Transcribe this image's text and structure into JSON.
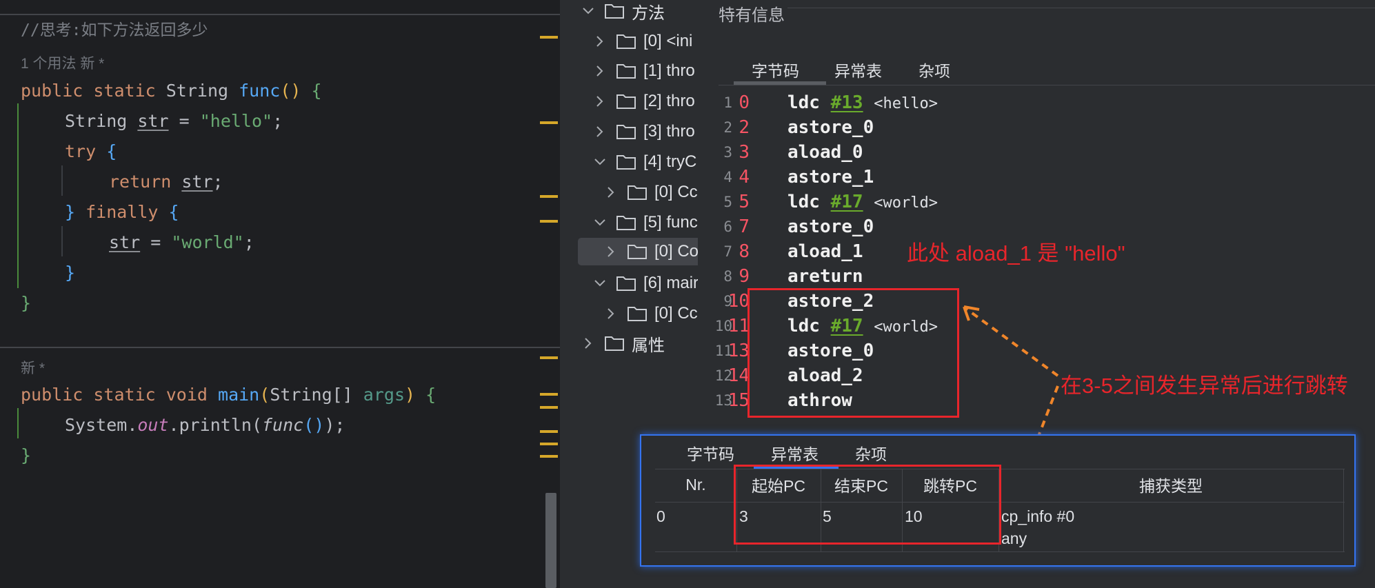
{
  "editor": {
    "comment": "//思考:如下方法返回多少",
    "usage_hint": "1 个用法   新 *",
    "new_hint": "新 *",
    "func": {
      "line1": [
        "public",
        "static",
        "String",
        "func",
        "()",
        "{"
      ],
      "line2": [
        "String",
        "str",
        "=",
        "\"hello\"",
        ";"
      ],
      "line3": [
        "try",
        "{"
      ],
      "line4": [
        "return",
        "str",
        ";"
      ],
      "line5": [
        "}",
        "finally",
        "{"
      ],
      "line6": [
        "str",
        "=",
        "\"world\"",
        ";"
      ],
      "line7": [
        "}"
      ],
      "line8": [
        "}"
      ]
    },
    "main": {
      "line1": [
        "public",
        "static",
        "void",
        "main",
        "(",
        "String[]",
        "args",
        ")",
        "{"
      ],
      "line2": [
        "System",
        ".",
        "out",
        ".println(",
        "func",
        "()",
        ");"
      ],
      "line3": [
        "}"
      ]
    }
  },
  "tree": {
    "methods_label": "方法",
    "items": [
      "[0] <ini",
      "[1] thro",
      "[2] thro",
      "[3] thro",
      "[4] tryC",
      "[0] Cc",
      "[5] func",
      "[0] Co",
      "[6] mair",
      "[0] Cc"
    ],
    "attributes_label": "属性"
  },
  "panel": {
    "section_title": "特有信息",
    "tabs": [
      "字节码",
      "异常表",
      "杂项"
    ],
    "bytecode": [
      {
        "ln": "1",
        "pc": "0",
        "op": "ldc",
        "ref": "#13",
        "arg": "<hello>"
      },
      {
        "ln": "2",
        "pc": "2",
        "op": "astore_0",
        "ref": "",
        "arg": ""
      },
      {
        "ln": "3",
        "pc": "3",
        "op": "aload_0",
        "ref": "",
        "arg": ""
      },
      {
        "ln": "4",
        "pc": "4",
        "op": "astore_1",
        "ref": "",
        "arg": ""
      },
      {
        "ln": "5",
        "pc": "5",
        "op": "ldc",
        "ref": "#17",
        "arg": "<world>"
      },
      {
        "ln": "6",
        "pc": "7",
        "op": "astore_0",
        "ref": "",
        "arg": ""
      },
      {
        "ln": "7",
        "pc": "8",
        "op": "aload_1",
        "ref": "",
        "arg": ""
      },
      {
        "ln": "8",
        "pc": "9",
        "op": "areturn",
        "ref": "",
        "arg": ""
      },
      {
        "ln": "9",
        "pc": "10",
        "op": "astore_2",
        "ref": "",
        "arg": ""
      },
      {
        "ln": "10",
        "pc": "11",
        "op": "ldc",
        "ref": "#17",
        "arg": "<world>"
      },
      {
        "ln": "11",
        "pc": "13",
        "op": "astore_0",
        "ref": "",
        "arg": ""
      },
      {
        "ln": "12",
        "pc": "14",
        "op": "aload_2",
        "ref": "",
        "arg": ""
      },
      {
        "ln": "13",
        "pc": "15",
        "op": "athrow",
        "ref": "",
        "arg": ""
      }
    ],
    "annotation_aload": "此处 aload_1 是 \"hello\"",
    "annotation_jump": "在3-5之间发生异常后进行跳转"
  },
  "exception_table": {
    "tabs": [
      "字节码",
      "异常表",
      "杂项"
    ],
    "headers": [
      "Nr.",
      "起始PC",
      "结束PC",
      "跳转PC",
      "捕获类型"
    ],
    "rows": [
      {
        "nr": "0",
        "start": "3",
        "end": "5",
        "handler": "10",
        "catch_type_line1": "cp_info #0",
        "catch_type_line2": "any"
      }
    ]
  },
  "colors": {
    "background": "#1e1f22",
    "panel": "#2b2d30",
    "annotation_red": "#e8252b",
    "arrow_orange": "#f0862a",
    "active_tab": "#3574f0"
  }
}
